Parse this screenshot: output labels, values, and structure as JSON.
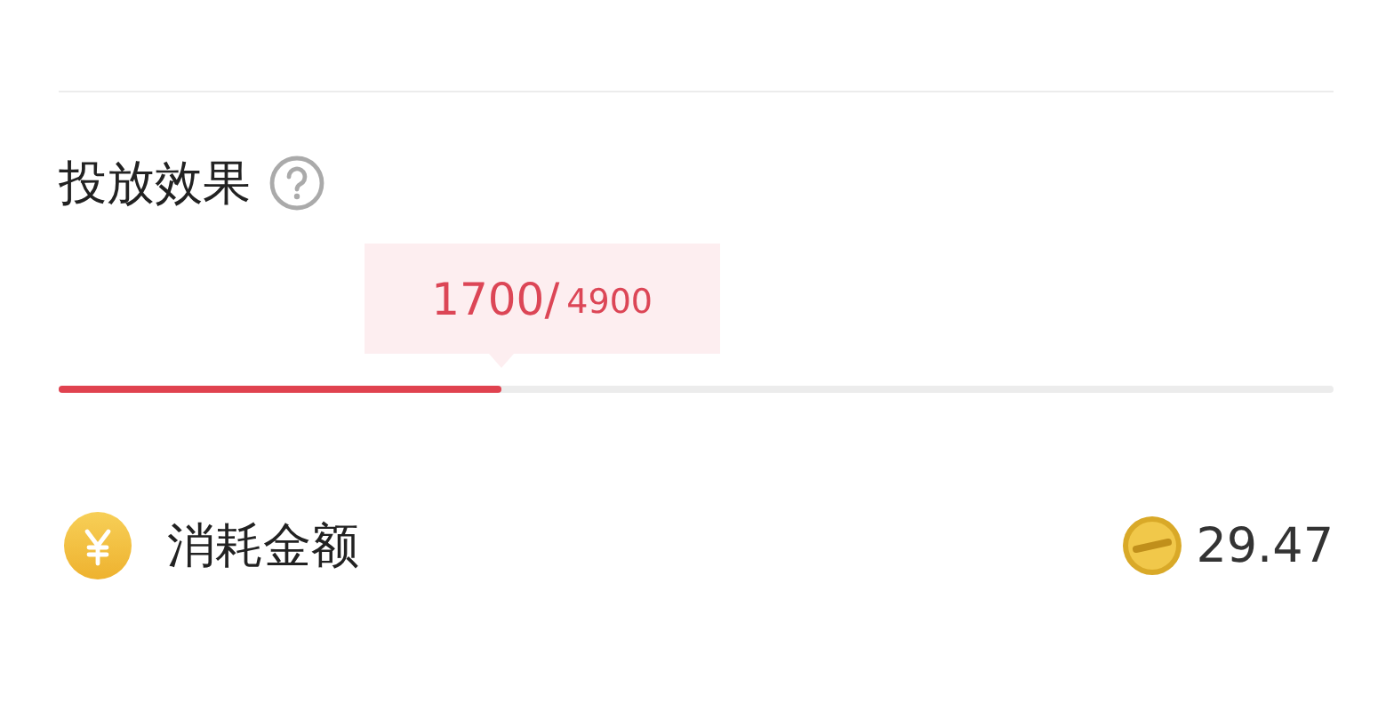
{
  "section": {
    "title": "投放效果",
    "progress": {
      "current": "1700/",
      "total": "4900",
      "level": 0.347
    }
  },
  "cost": {
    "label": "消耗金额",
    "value": "29.47"
  }
}
